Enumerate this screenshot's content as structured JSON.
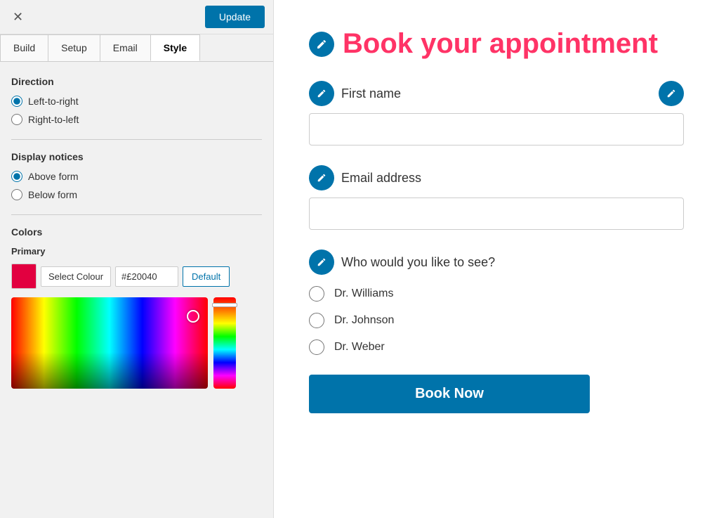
{
  "topbar": {
    "close_label": "✕",
    "update_label": "Update"
  },
  "tabs": [
    {
      "id": "build",
      "label": "Build",
      "active": false
    },
    {
      "id": "setup",
      "label": "Setup",
      "active": false
    },
    {
      "id": "email",
      "label": "Email",
      "active": false
    },
    {
      "id": "style",
      "label": "Style",
      "active": true
    }
  ],
  "direction": {
    "title": "Direction",
    "options": [
      {
        "label": "Left-to-right",
        "value": "ltr",
        "checked": true
      },
      {
        "label": "Right-to-left",
        "value": "rtl",
        "checked": false
      }
    ]
  },
  "display_notices": {
    "title": "Display notices",
    "options": [
      {
        "label": "Above form",
        "value": "above",
        "checked": true
      },
      {
        "label": "Below form",
        "value": "below",
        "checked": false
      }
    ]
  },
  "colors": {
    "title": "Colors",
    "primary_label": "Primary",
    "select_colour_btn": "Select Colour",
    "hex_value": "#£20040",
    "default_btn": "Default",
    "swatch_color": "#e20040"
  },
  "form": {
    "title": "Book your appointment",
    "fields": [
      {
        "id": "first-name",
        "label": "First name",
        "type": "text",
        "placeholder": ""
      },
      {
        "id": "email",
        "label": "Email address",
        "type": "email",
        "placeholder": ""
      }
    ],
    "question": {
      "label": "Who would you like to see?",
      "options": [
        {
          "label": "Dr. Williams"
        },
        {
          "label": "Dr. Johnson"
        },
        {
          "label": "Dr. Weber"
        }
      ]
    },
    "submit_btn": "Book Now"
  }
}
